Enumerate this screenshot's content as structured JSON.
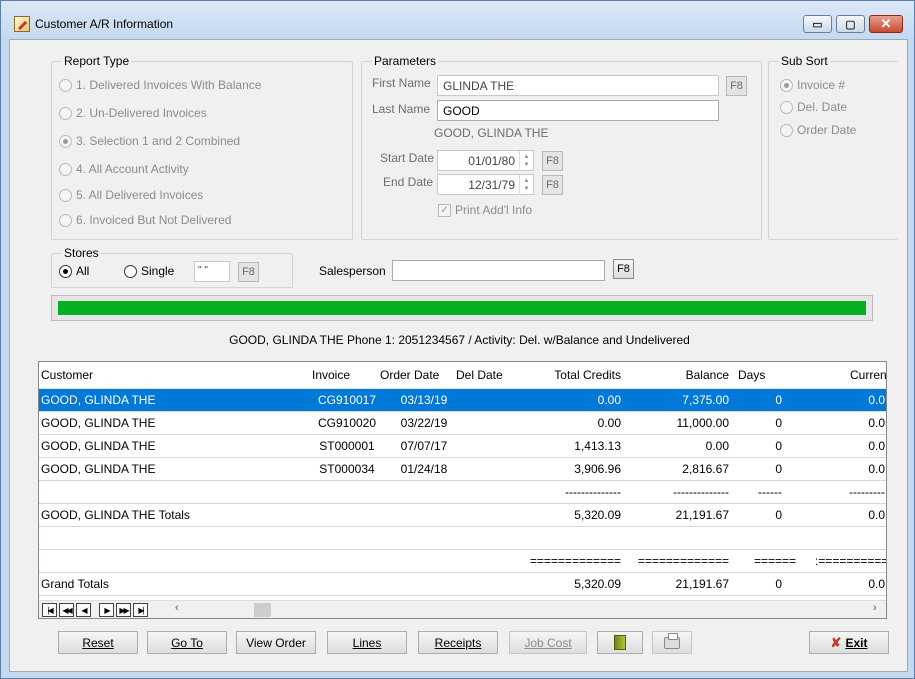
{
  "window": {
    "title": "Customer A/R Information",
    "min": "▭",
    "max": "▢",
    "close": "✕"
  },
  "report_type": {
    "title": "Report Type",
    "options": [
      {
        "label": "1. Delivered Invoices With Balance",
        "checked": false
      },
      {
        "label": "2. Un-Delivered Invoices",
        "checked": false
      },
      {
        "label": "3. Selection 1 and 2 Combined",
        "checked": true
      },
      {
        "label": "4. All Account Activity",
        "checked": false
      },
      {
        "label": "5. All Delivered Invoices",
        "checked": false
      },
      {
        "label": "6. Invoiced But Not Delivered",
        "checked": false
      }
    ]
  },
  "parameters": {
    "title": "Parameters",
    "first_name_label": "First Name",
    "first_name": "GLINDA THE",
    "last_name_label": "Last Name",
    "last_name": "GOOD",
    "full_name": "GOOD, GLINDA THE",
    "start_date_label": "Start Date",
    "start_date": "01/01/80",
    "end_date_label": "End Date",
    "end_date": "12/31/79",
    "print_addl_info": "Print Add'l Info",
    "f8": "F8"
  },
  "sub_sort": {
    "title": "Sub Sort",
    "options": [
      {
        "label": "Invoice #",
        "checked": true
      },
      {
        "label": "Del. Date",
        "checked": false
      },
      {
        "label": "Order Date",
        "checked": false
      }
    ]
  },
  "stores": {
    "title": "Stores",
    "all": "All",
    "single": "Single",
    "store_value": "\" \"",
    "f8": "F8"
  },
  "salesperson": {
    "label": "Salesperson",
    "value": "",
    "f8": "F8"
  },
  "progress": {
    "percent": 100,
    "color": "#06b025"
  },
  "status_text": "GOOD, GLINDA THE Phone 1: 2051234567 /  Activity: Del. w/Balance and Undelivered",
  "grid": {
    "headers": {
      "customer": "Customer",
      "invoice": "Invoice",
      "order_date": "Order Date",
      "del_date": "Del Date",
      "total_credits": "Total Credits",
      "balance": "Balance",
      "days": "Days",
      "current": "Current"
    },
    "rows": [
      {
        "customer": "GOOD, GLINDA THE",
        "invoice": "CG910017",
        "order_date": "03/13/19",
        "del_date": "",
        "total_credits": "0.00",
        "balance": "7,375.00",
        "days": "0",
        "current": "0.0"
      },
      {
        "customer": "GOOD, GLINDA THE",
        "invoice": "CG910020",
        "order_date": "03/22/19",
        "del_date": "",
        "total_credits": "0.00",
        "balance": "11,000.00",
        "days": "0",
        "current": "0.0"
      },
      {
        "customer": "GOOD, GLINDA THE",
        "invoice": "ST000001",
        "order_date": "07/07/17",
        "del_date": "",
        "total_credits": "1,413.13",
        "balance": "0.00",
        "days": "0",
        "current": "0.0"
      },
      {
        "customer": "GOOD, GLINDA THE",
        "invoice": "ST000034",
        "order_date": "01/24/18",
        "del_date": "",
        "total_credits": "3,906.96",
        "balance": "2,816.67",
        "days": "0",
        "current": "0.0"
      },
      {
        "customer": "",
        "invoice": "",
        "order_date": "",
        "del_date": "",
        "total_credits": "--------------",
        "balance": "--------------",
        "days": "------",
        "current": "---------"
      },
      {
        "customer": "GOOD, GLINDA THE Totals",
        "invoice": "",
        "order_date": "",
        "del_date": "",
        "total_credits": "5,320.09",
        "balance": "21,191.67",
        "days": "0",
        "current": "0.0"
      },
      {
        "customer": "",
        "invoice": "",
        "order_date": "",
        "del_date": "",
        "total_credits": "",
        "balance": "",
        "days": "",
        "current": ""
      },
      {
        "customer": "",
        "invoice": "",
        "order_date": "",
        "del_date": "",
        "total_credits": "=============",
        "balance": "=============",
        "days": "======",
        "current": ":============"
      },
      {
        "customer": "Grand Totals",
        "invoice": "",
        "order_date": "",
        "del_date": "",
        "total_credits": "5,320.09",
        "balance": "21,191.67",
        "days": "0",
        "current": "0.0"
      }
    ]
  },
  "nav": {
    "first": "|◀",
    "prev_page": "◀◀",
    "prev": "◀",
    "next": "▶",
    "next_page": "▶▶",
    "last": "▶|",
    "left": "‹",
    "right": "›"
  },
  "buttons": {
    "reset": "Reset",
    "goto": "Go To",
    "view_order": "View Order",
    "lines": "Lines",
    "receipts": "Receipts",
    "job_cost": "Job Cost",
    "exit": "Exit",
    "exit_icon": "✘"
  }
}
